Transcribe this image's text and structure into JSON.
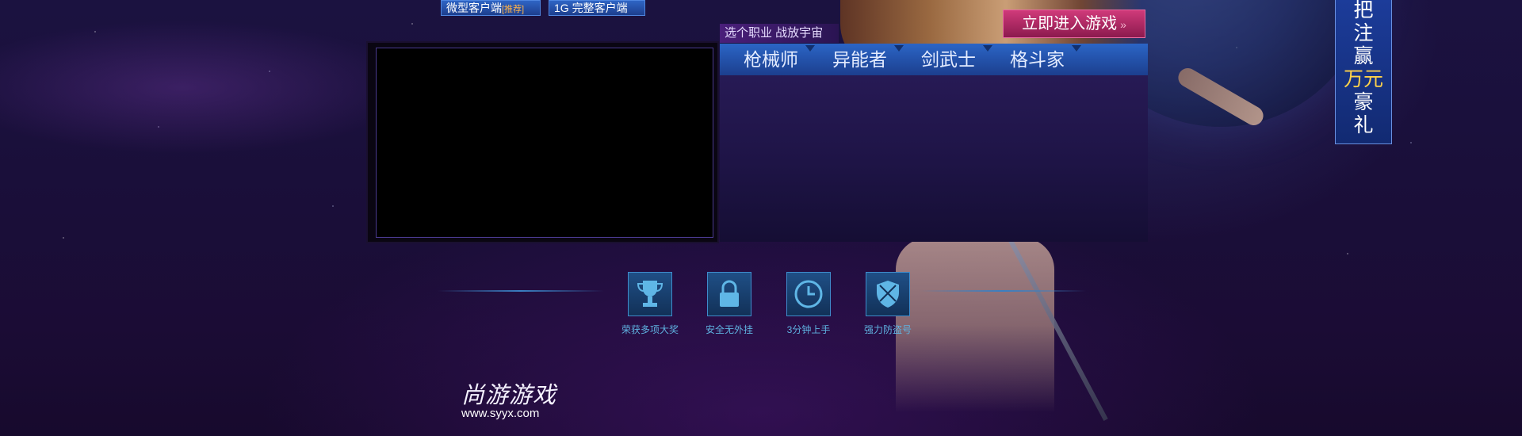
{
  "top_links": {
    "micro_client": "微型客户端",
    "micro_tag": "[推荐]",
    "full_client": "1G 完整客户端"
  },
  "enter_game": {
    "label": "立即进入游戏",
    "arrow": "»"
  },
  "panel": {
    "tagline": "选个职业  战放宇宙"
  },
  "class_tabs": [
    {
      "label": "枪械师"
    },
    {
      "label": "异能者"
    },
    {
      "label": "剑武士"
    },
    {
      "label": "格斗家"
    }
  ],
  "features": [
    {
      "icon": "trophy-icon",
      "label": "荣获多项大奖"
    },
    {
      "icon": "lock-icon",
      "label": "安全无外挂"
    },
    {
      "icon": "clock-icon",
      "label": "3分钟上手"
    },
    {
      "icon": "shield-icon",
      "label": "强力防盗号"
    }
  ],
  "logo": {
    "name": "尚游游戏",
    "url": "www.syyx.com"
  },
  "side_banner": {
    "lines": [
      "把",
      "注",
      "赢"
    ],
    "money": "万元",
    "gift_lines": [
      "豪",
      "礼"
    ]
  },
  "colors": {
    "accent_blue": "#2b65c6",
    "enter_pink": "#c0306c",
    "background": "#1a0f3a",
    "feature_text": "#5fb2e0",
    "money_gold": "#ffd24a"
  }
}
